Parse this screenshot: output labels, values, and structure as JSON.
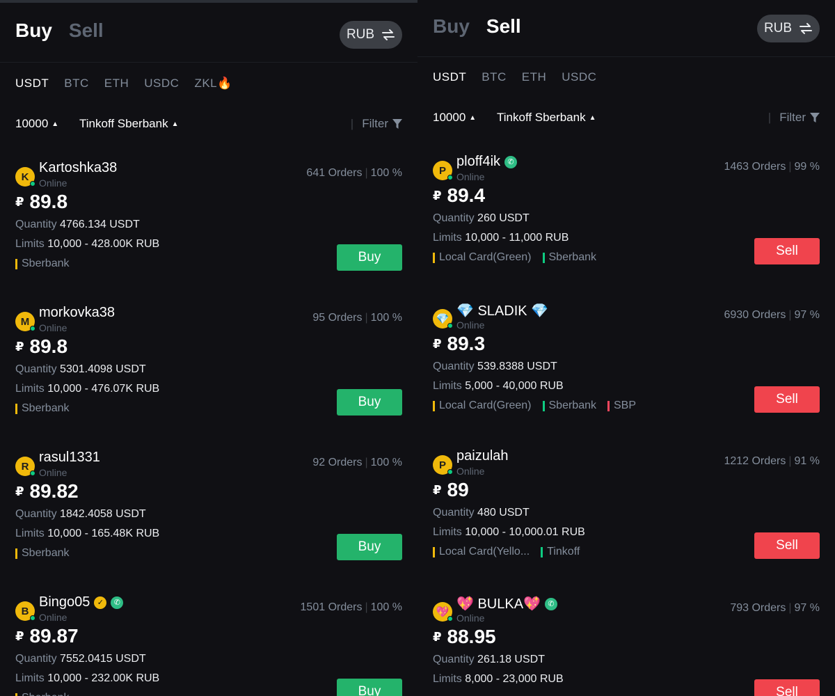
{
  "colors": {
    "background": "#101014",
    "buy_button": "#24b36b",
    "sell_button": "#f0444d",
    "pay_yellow": "#f0b90b",
    "pay_green": "#0ecb81",
    "pay_red": "#f6465d",
    "muted_text": "#848e9c"
  },
  "left": {
    "tabs": {
      "buy": "Buy",
      "sell": "Sell",
      "active": "buy"
    },
    "currency": "RUB",
    "coins": [
      "USDT",
      "BTC",
      "ETH",
      "USDC",
      "ZKL🔥"
    ],
    "active_coin": "USDT",
    "filters": {
      "amount": "10000",
      "payment": "Tinkoff Sberbank",
      "filter": "Filter"
    },
    "ads": [
      {
        "avatar": "K",
        "name": "Kartoshka38",
        "status": "Online",
        "orders": "641 Orders",
        "completion": "100 %",
        "currency_symbol": "₽",
        "price": "89.8",
        "qty_label": "Quantity",
        "qty": "4766.134 USDT",
        "limits_label": "Limits",
        "limits": "10,000 - 428.00K RUB",
        "pays": [
          {
            "label": "Sberbank",
            "color": "#f0b90b"
          }
        ],
        "action": "Buy"
      },
      {
        "avatar": "M",
        "name": "morkovka38",
        "status": "Online",
        "orders": "95 Orders",
        "completion": "100 %",
        "currency_symbol": "₽",
        "price": "89.8",
        "qty_label": "Quantity",
        "qty": "5301.4098 USDT",
        "limits_label": "Limits",
        "limits": "10,000 - 476.07K RUB",
        "pays": [
          {
            "label": "Sberbank",
            "color": "#f0b90b"
          }
        ],
        "action": "Buy"
      },
      {
        "avatar": "R",
        "name": "rasul1331",
        "status": "Online",
        "orders": "92 Orders",
        "completion": "100 %",
        "currency_symbol": "₽",
        "price": "89.82",
        "qty_label": "Quantity",
        "qty": "1842.4058 USDT",
        "limits_label": "Limits",
        "limits": "10,000 - 165.48K RUB",
        "pays": [
          {
            "label": "Sberbank",
            "color": "#f0b90b"
          }
        ],
        "action": "Buy"
      },
      {
        "avatar": "B",
        "name": "Bingo05",
        "status": "Online",
        "orders": "1501 Orders",
        "completion": "100 %",
        "currency_symbol": "₽",
        "price": "89.87",
        "qty_label": "Quantity",
        "qty": "7552.0415 USDT",
        "limits_label": "Limits",
        "limits": "10,000 - 232.00K RUB",
        "pays": [
          {
            "label": "Sberbank",
            "color": "#f0b90b"
          }
        ],
        "action": "Buy"
      }
    ]
  },
  "right": {
    "tabs": {
      "buy": "Buy",
      "sell": "Sell",
      "active": "sell"
    },
    "currency": "RUB",
    "coins": [
      "USDT",
      "BTC",
      "ETH",
      "USDC"
    ],
    "active_coin": "USDT",
    "filters": {
      "amount": "10000",
      "payment": "Tinkoff Sberbank",
      "filter": "Filter"
    },
    "ads": [
      {
        "avatar": "P",
        "name": "ploff4ik",
        "status": "Online",
        "orders": "1463 Orders",
        "completion": "99 %",
        "currency_symbol": "₽",
        "price": "89.4",
        "qty_label": "Quantity",
        "qty": "260 USDT",
        "limits_label": "Limits",
        "limits": "10,000 - 11,000 RUB",
        "pays": [
          {
            "label": "Local Card(Green)",
            "color": "#f0b90b"
          },
          {
            "label": "Sberbank",
            "color": "#0ecb81"
          }
        ],
        "action": "Sell"
      },
      {
        "avatar": "💎",
        "name": "💎 SLADIK 💎",
        "status": "Online",
        "orders": "6930 Orders",
        "completion": "97 %",
        "currency_symbol": "₽",
        "price": "89.3",
        "qty_label": "Quantity",
        "qty": "539.8388 USDT",
        "limits_label": "Limits",
        "limits": "5,000 - 40,000 RUB",
        "pays": [
          {
            "label": "Local Card(Green)",
            "color": "#f0b90b"
          },
          {
            "label": "Sberbank",
            "color": "#0ecb81"
          },
          {
            "label": "SBP",
            "color": "#f6465d"
          }
        ],
        "action": "Sell"
      },
      {
        "avatar": "P",
        "name": "paizulah",
        "status": "Online",
        "orders": "1212 Orders",
        "completion": "91 %",
        "currency_symbol": "₽",
        "price": "89",
        "qty_label": "Quantity",
        "qty": "480 USDT",
        "limits_label": "Limits",
        "limits": "10,000 - 10,000.01 RUB",
        "pays": [
          {
            "label": "Local Card(Yello...",
            "color": "#f0b90b"
          },
          {
            "label": "Tinkoff",
            "color": "#0ecb81"
          }
        ],
        "action": "Sell"
      },
      {
        "avatar": "💖",
        "name": "💖 BULKA💖",
        "status": "Online",
        "orders": "793 Orders",
        "completion": "97 %",
        "currency_symbol": "₽",
        "price": "88.95",
        "qty_label": "Quantity",
        "qty": "261.18 USDT",
        "limits_label": "Limits",
        "limits": "8,000 - 23,000 RUB",
        "pays": [],
        "action": "Sell"
      }
    ]
  }
}
